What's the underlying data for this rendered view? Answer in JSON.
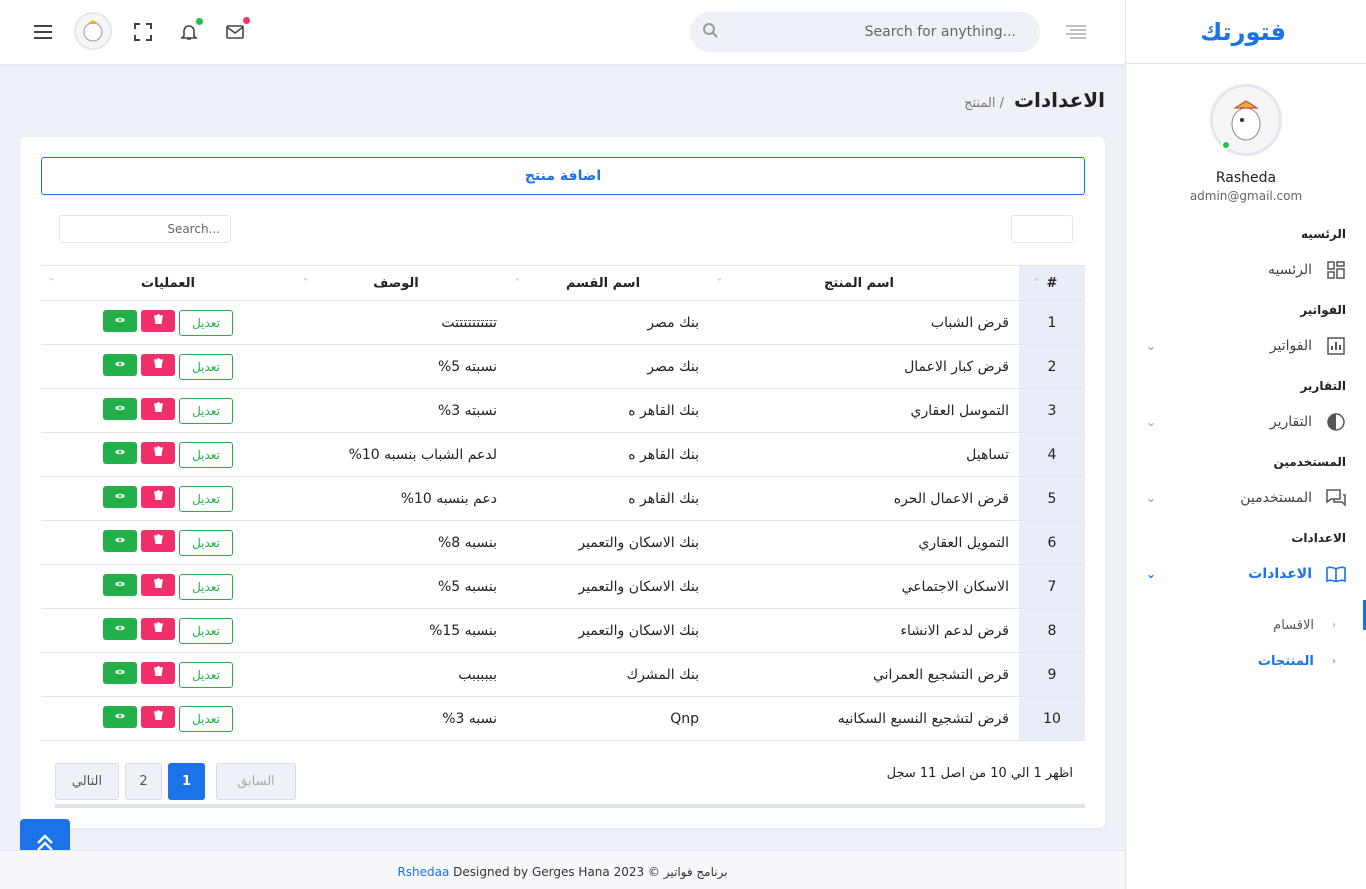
{
  "brand": {
    "name": "فتورتك"
  },
  "profile": {
    "name": "Rasheda",
    "email": "admin@gmail.com"
  },
  "nav": {
    "sections": [
      {
        "head": "الرئسيه",
        "label": "الرئسيه",
        "icon": "dashboard-icon"
      },
      {
        "head": "الفواتير",
        "label": "الفواتير",
        "icon": "bar-chart-icon"
      },
      {
        "head": "التقارير",
        "label": "التقارير",
        "icon": "pie-chart-icon"
      },
      {
        "head": "المستخدمين",
        "label": "المستخدمين",
        "icon": "chat-icon"
      },
      {
        "head": "الاعدادات",
        "label": "الاعدادات",
        "icon": "book-icon"
      }
    ],
    "sub_items": [
      "الاقسام",
      "المنتجات"
    ]
  },
  "topbar": {
    "search_placeholder": "Search for anything..."
  },
  "breadcrumb": {
    "title": "الاعدادات",
    "sub": "/ المنتج"
  },
  "card": {
    "add_button": "اضافة منتج",
    "search_placeholder": "Search...",
    "columns": [
      "#",
      "اسم المنتج",
      "اسم القسم",
      "الوصف",
      "العمليات"
    ],
    "edit_label": "تعديل",
    "rows": [
      [
        "1",
        "قرض الشباب",
        "بنك مصر",
        "تتتتتتتتتتت"
      ],
      [
        "2",
        "قرض كبار الاعمال",
        "بنك مصر",
        "نسبته 5%"
      ],
      [
        "3",
        "التموسل العقاري",
        "بنك القاهر ه",
        "نسبته 3%"
      ],
      [
        "4",
        "تساهيل",
        "بنك القاهر ه",
        "لدعم الشباب بنسبه 10%"
      ],
      [
        "5",
        "قرض الاعمال الحره",
        "بنك القاهر ه",
        "دعم بنسبه 10%"
      ],
      [
        "6",
        "التمويل العقاري",
        "بنك الاسكان والتعمير",
        "بنسبه 8%"
      ],
      [
        "7",
        "الاسكان الاجتماعي",
        "بنك الاسكان والتعمير",
        "بنسبه 5%"
      ],
      [
        "8",
        "قرض لدعم الانشاء",
        "بنك الاسكان والتعمير",
        "بنسبه 15%"
      ],
      [
        "9",
        "قرض التشجيع العمراني",
        "بنك المشرك",
        "ببببببب"
      ],
      [
        "10",
        "قرض لتشجيع النسبع السكانيه",
        "Qnp",
        "نسبه 3%"
      ]
    ],
    "info": "اظهر 1 الي 10 من اصل 11 سجل",
    "pager": {
      "next": "التالي",
      "page2": "2",
      "page1": "1",
      "prev": "السابق"
    }
  },
  "footer": {
    "brand": "Rshedaa",
    "text": " Designed by Gerges Hana 2023 © برنامج فواتير"
  },
  "colors": {
    "accent": "#1a73e8",
    "success": "#22b04a",
    "danger": "#f0306a"
  }
}
